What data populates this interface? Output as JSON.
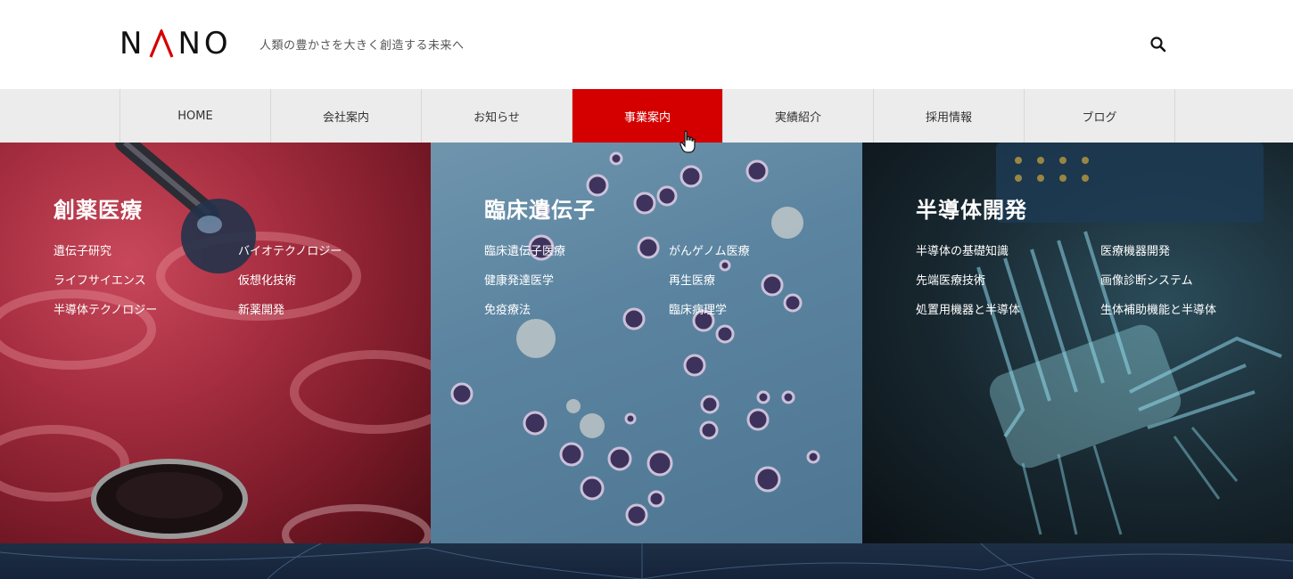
{
  "header": {
    "logo_letters": [
      "N",
      "A",
      "N",
      "O"
    ],
    "logo_text": "NANO",
    "tagline": "人類の豊かさを大きく創造する未来へ",
    "search_icon": "search-icon"
  },
  "nav": {
    "items": [
      {
        "label": "HOME",
        "active": false
      },
      {
        "label": "会社案内",
        "active": false
      },
      {
        "label": "お知らせ",
        "active": false
      },
      {
        "label": "事業案内",
        "active": true
      },
      {
        "label": "実績紹介",
        "active": false
      },
      {
        "label": "採用情報",
        "active": false
      },
      {
        "label": "ブログ",
        "active": false
      }
    ],
    "active_color": "#d40000"
  },
  "panels": [
    {
      "title": "創薬医療",
      "links": [
        "遺伝子研究",
        "バイオテクノロジー",
        "ライフサイエンス",
        "仮想化技術",
        "半導体テクノロジー",
        "新薬開発"
      ]
    },
    {
      "title": "臨床遺伝子",
      "links": [
        "臨床遺伝子医療",
        "がんゲノム医療",
        "健康発達医学",
        "再生医療",
        "免疫療法",
        "臨床病理学"
      ]
    },
    {
      "title": "半導体開発",
      "links": [
        "半導体の基礎知識",
        "医療機器開発",
        "先端医療技術",
        "画像診断システム",
        "処置用機器と半導体",
        "生体補助機能と半導体"
      ]
    }
  ],
  "colors": {
    "accent": "#d40000",
    "nav_bg": "#ececec"
  }
}
